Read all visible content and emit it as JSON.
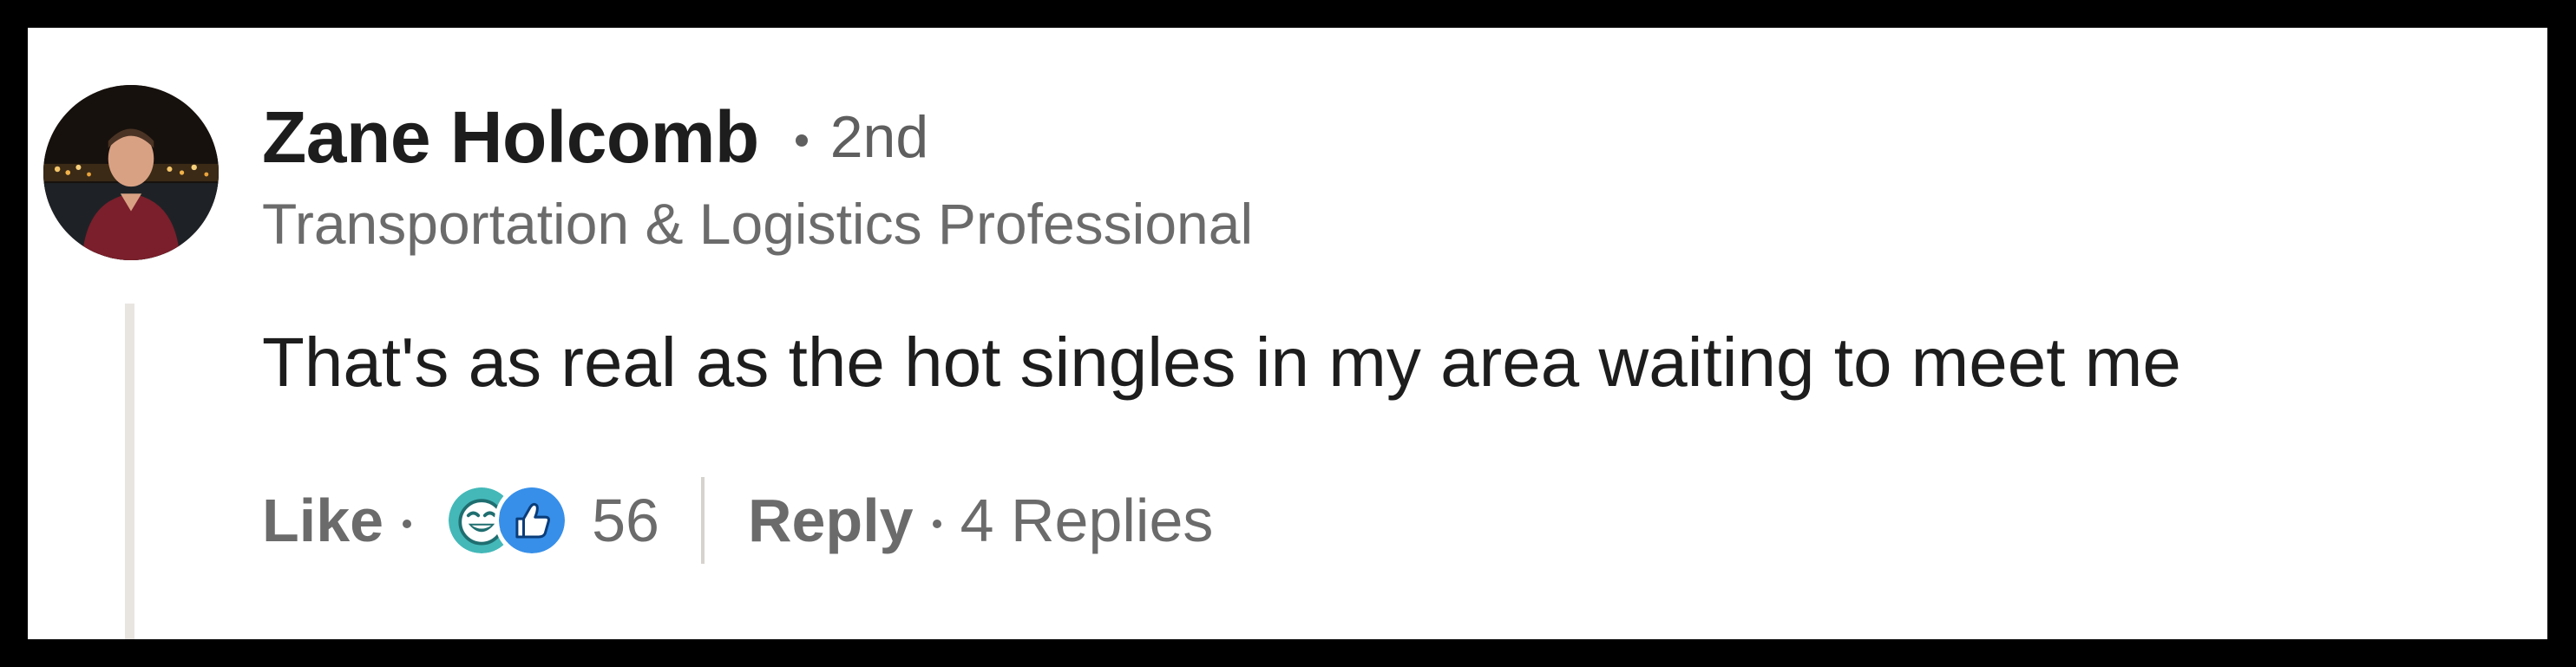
{
  "comment": {
    "author": {
      "name": "Zane Holcomb",
      "degree": "2nd",
      "headline": "Transportation & Logistics Professional",
      "avatar_icon": "profile-photo"
    },
    "text": "That's as real as the hot singles in my area waiting to meet me",
    "actions": {
      "like_label": "Like",
      "reaction_icons": [
        "funny-laugh-icon",
        "like-thumbs-up-icon"
      ],
      "reaction_count": "56",
      "reply_label": "Reply",
      "replies_count": "4 Replies"
    }
  },
  "colors": {
    "frame": "#000000",
    "card": "#ffffff",
    "text_primary": "#1d1d1d",
    "text_secondary": "#6b6b6b",
    "thread_line": "#e8e5e1",
    "funny_reaction": "#44b8b8",
    "like_reaction": "#378fe9"
  }
}
